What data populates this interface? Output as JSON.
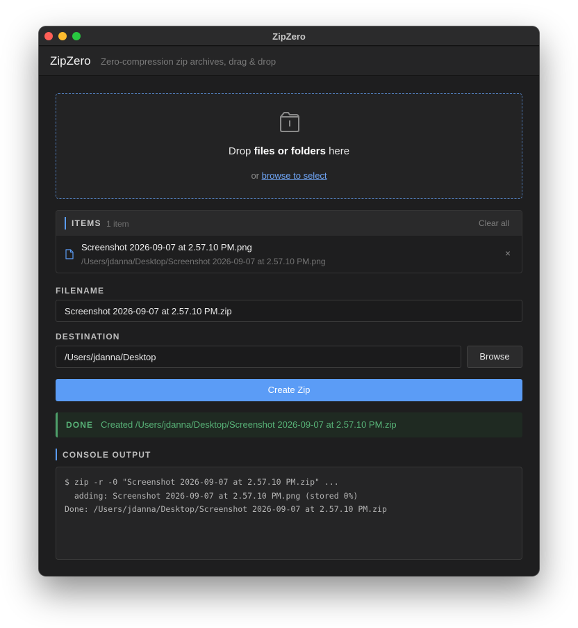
{
  "window": {
    "title": "ZipZero",
    "traffic_lights": [
      "close",
      "minimize",
      "maximize"
    ]
  },
  "header": {
    "app_name": "ZipZero",
    "tagline": "Zero-compression zip archives, drag & drop"
  },
  "dropzone": {
    "icon": "folder-icon",
    "text_prefix": "Drop ",
    "text_bold": "files or folders",
    "text_suffix": " here",
    "browse_prefix": "or ",
    "browse_link": "browse to select"
  },
  "items": {
    "title": "ITEMS",
    "count": "1 item",
    "clear_label": "Clear all",
    "list": [
      {
        "icon": "file-icon",
        "name": "Screenshot 2026-09-07 at 2.57.10 PM.png",
        "path": "/Users/jdanna/Desktop/Screenshot 2026-09-07 at 2.57.10 PM.png",
        "remove": "×"
      }
    ]
  },
  "filename": {
    "label": "FILENAME",
    "value": "Screenshot 2026-09-07 at 2.57.10 PM.zip"
  },
  "destination": {
    "label": "DESTINATION",
    "value": "/Users/jdanna/Desktop",
    "browse_label": "Browse"
  },
  "create_button": "Create Zip",
  "status": {
    "tag": "DONE",
    "message": "Created /Users/jdanna/Desktop/Screenshot 2026-09-07 at 2.57.10 PM.zip"
  },
  "console": {
    "label": "CONSOLE OUTPUT",
    "lines": [
      "$ zip -r -0 \"Screenshot 2026-09-07 at 2.57.10 PM.zip\" ...",
      "  adding: Screenshot 2026-09-07 at 2.57.10 PM.png (stored 0%)",
      "",
      "Done: /Users/jdanna/Desktop/Screenshot 2026-09-07 at 2.57.10 PM.zip"
    ]
  },
  "colors": {
    "accent": "#5b9cf6",
    "success": "#58b378",
    "background": "#1e1e1f"
  }
}
